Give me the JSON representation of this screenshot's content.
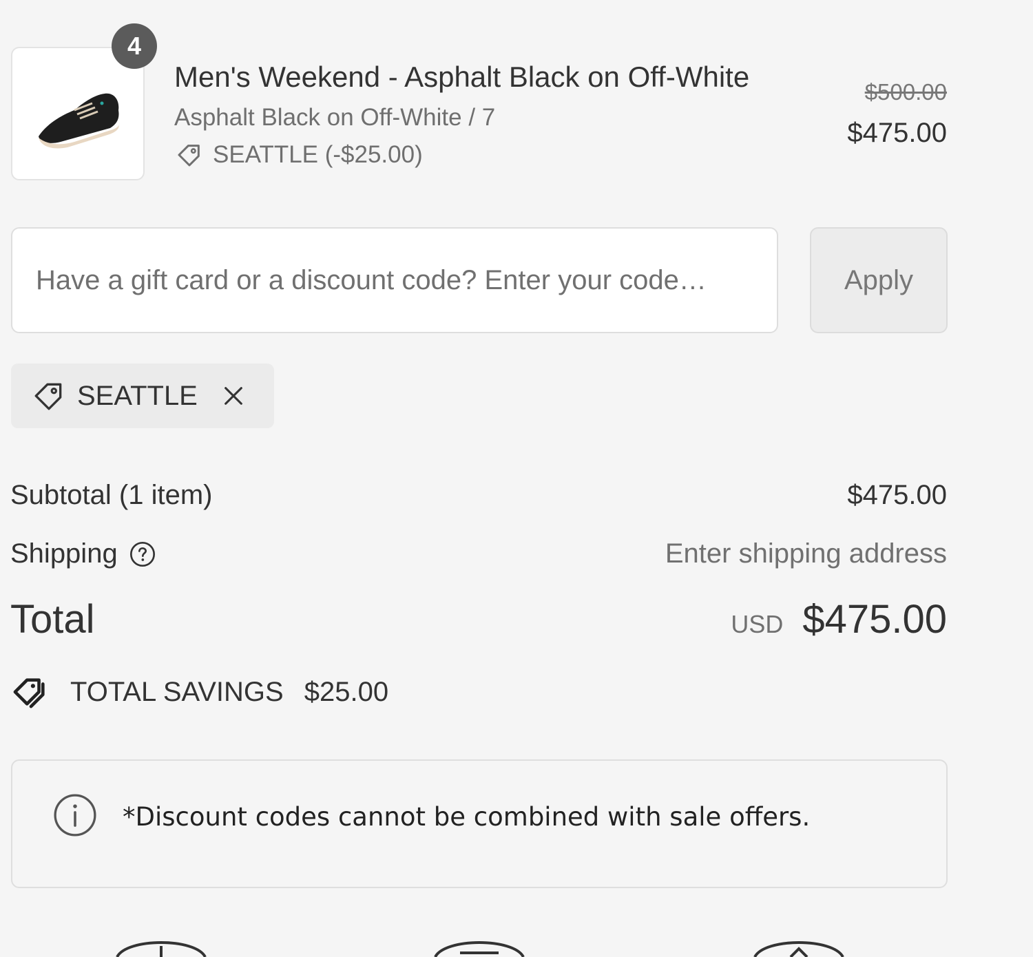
{
  "line_item": {
    "quantity": "4",
    "name": "Men's Weekend - Asphalt Black on Off-White",
    "variant": "Asphalt Black on Off-White / 7",
    "discount": "SEATTLE (-$25.00)",
    "original_price": "$500.00",
    "price": "$475.00",
    "image_icon": "sneaker-product-image"
  },
  "discount_form": {
    "placeholder": "Have a gift card or a discount code? Enter your code…",
    "value": "",
    "apply_label": "Apply"
  },
  "applied_code": {
    "code": "SEATTLE",
    "remove_icon": "close-icon"
  },
  "totals": {
    "subtotal_label": "Subtotal (1 item)",
    "subtotal_value": "$475.00",
    "shipping_label": "Shipping",
    "shipping_value": "Enter shipping address",
    "total_label": "Total",
    "currency": "USD",
    "total_value": "$475.00"
  },
  "savings": {
    "label": "TOTAL SAVINGS",
    "amount": "$25.00"
  },
  "notice": {
    "text": "*Discount codes cannot be combined with sale offers."
  },
  "colors": {
    "background": "#f5f5f5",
    "badge": "#5b5b5b",
    "text": "#333333",
    "muted": "#707070"
  }
}
